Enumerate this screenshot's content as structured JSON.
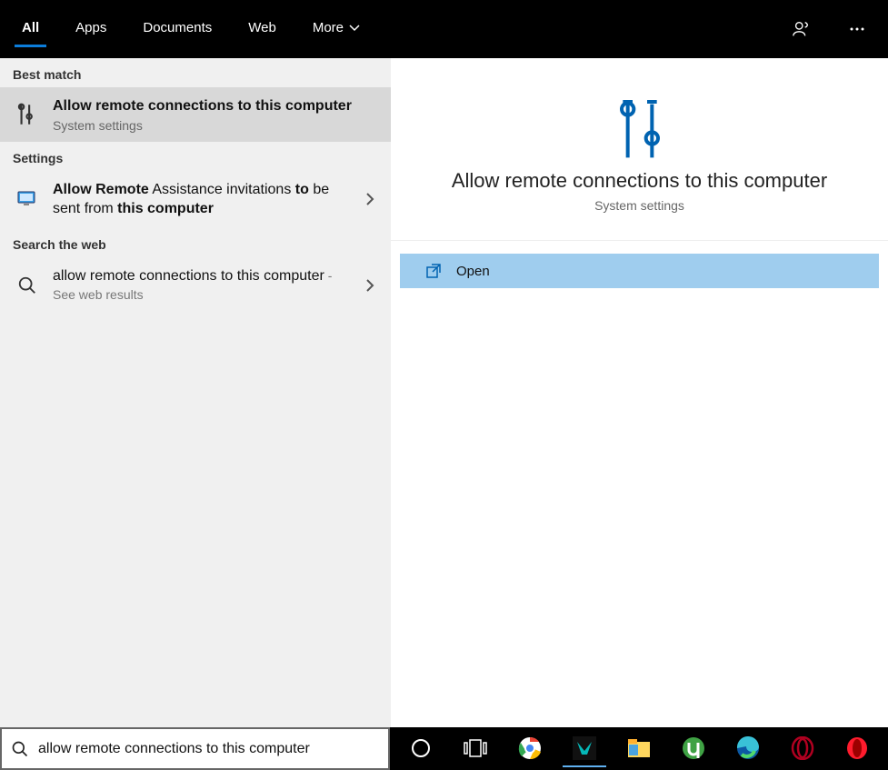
{
  "tabs": {
    "all": "All",
    "apps": "Apps",
    "documents": "Documents",
    "web": "Web",
    "more": "More"
  },
  "sections": {
    "best_match": "Best match",
    "settings": "Settings",
    "search_web": "Search the web"
  },
  "best_match_item": {
    "title": "Allow remote connections to this computer",
    "subtitle": "System settings"
  },
  "settings_item": {
    "pre_bold": "Allow Remote",
    "mid": " Assistance invitations ",
    "bold2": "to",
    "mid2": " be sent from ",
    "bold3": "this computer"
  },
  "web_item": {
    "query": "allow remote connections to this computer",
    "suffix": " - See web results"
  },
  "preview": {
    "title": "Allow remote connections to this computer",
    "subtitle": "System settings",
    "open": "Open"
  },
  "search": {
    "value": "allow remote connections to this computer"
  },
  "taskbar": {
    "cortana": "cortana",
    "taskview": "taskview",
    "chrome": "chrome",
    "predator": "predator",
    "explorer": "explorer",
    "utorrent": "utorrent",
    "edge": "edge",
    "opera_gx": "opera_gx",
    "opera": "opera"
  }
}
